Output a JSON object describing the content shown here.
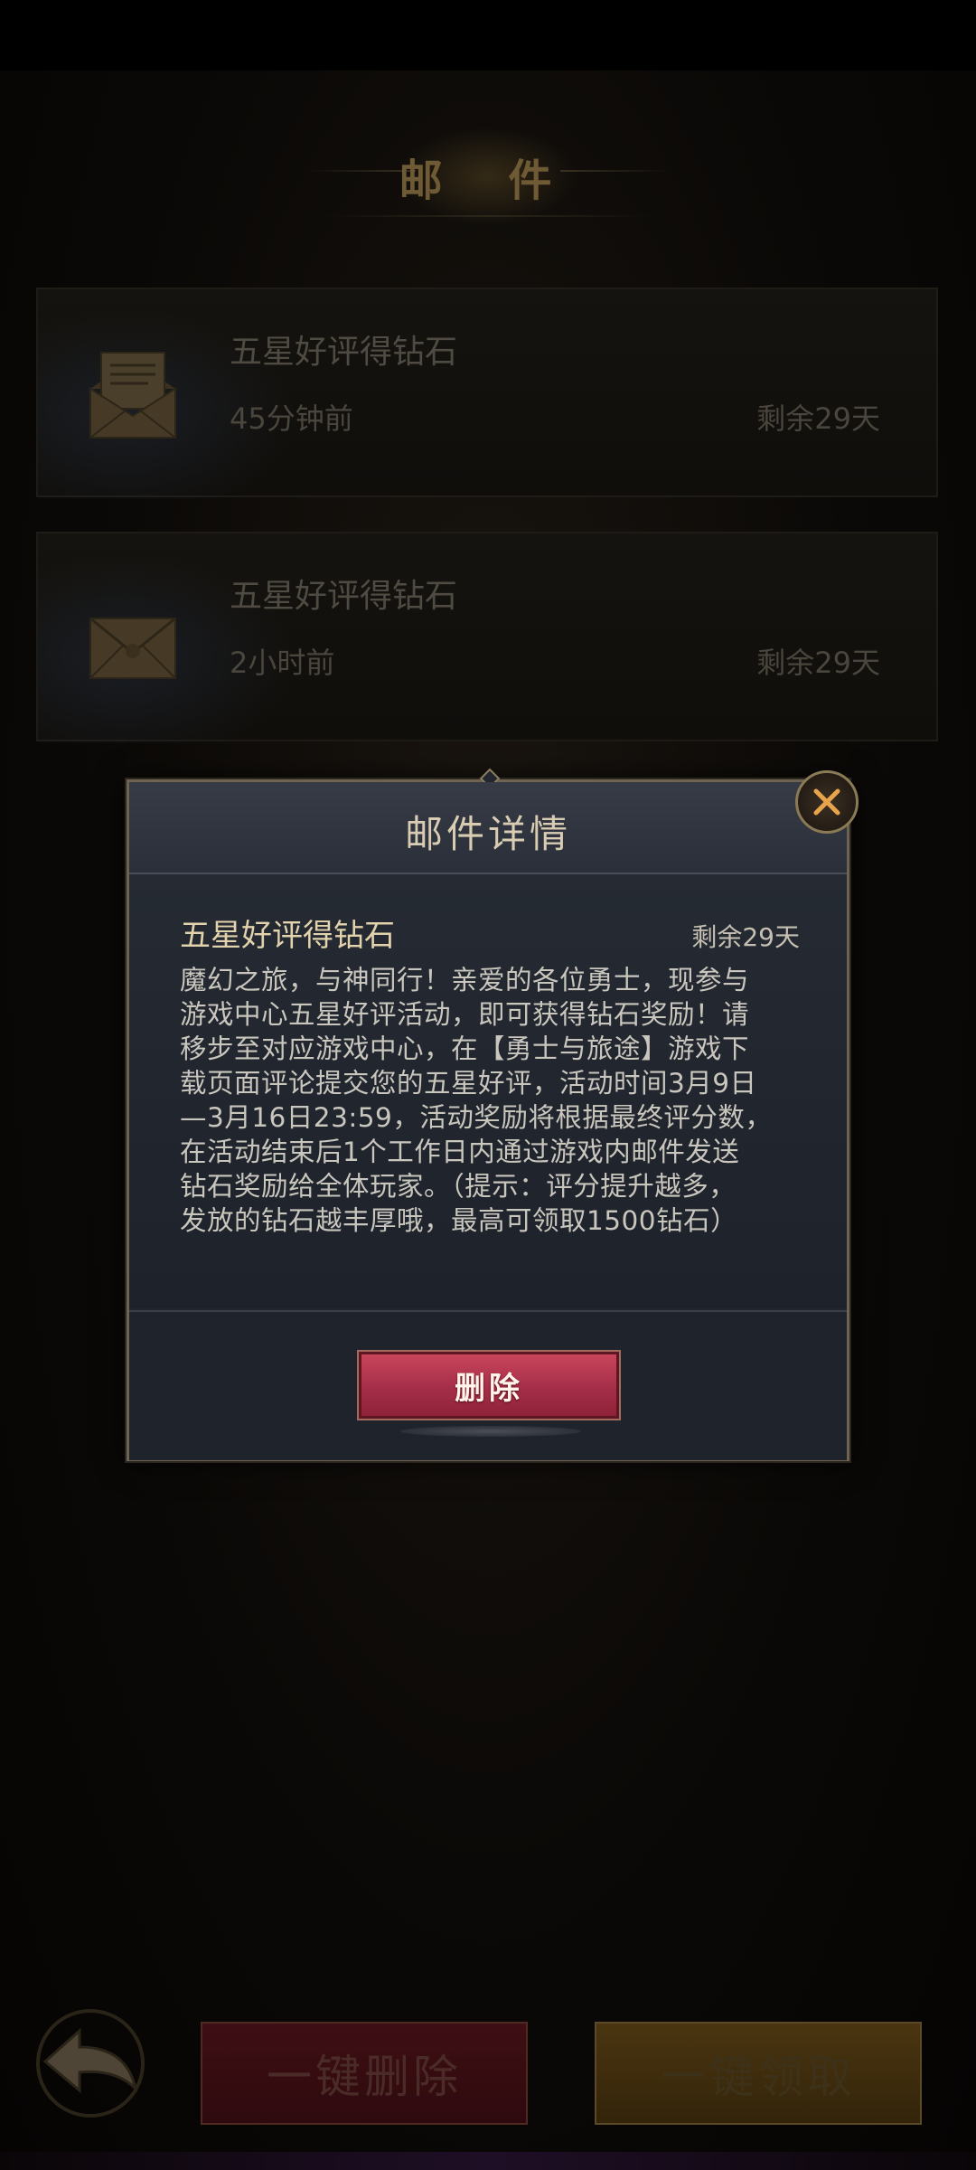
{
  "header": {
    "title": "邮 件"
  },
  "mail_list": [
    {
      "subject": "五星好评得钻石",
      "time": "45分钟前",
      "remaining": "剩余29天",
      "icon": "open-envelope-icon"
    },
    {
      "subject": "五星好评得钻石",
      "time": "2小时前",
      "remaining": "剩余29天",
      "icon": "closed-envelope-icon"
    }
  ],
  "detail_modal": {
    "title": "邮件详情",
    "subject": "五星好评得钻石",
    "remaining": "剩余29天",
    "body_lines": [
      "魔幻之旅，与神同行！亲爱的各位勇士，现参与",
      "游戏中心五星好评活动，即可获得钻石奖励！请",
      "移步至对应游戏中心，在【勇士与旅途】游戏下",
      "载页面评论提交您的五星好评，活动时间3月9日",
      "—3月16日23:59，活动奖励将根据最终评分数，",
      "在活动结束后1个工作日内通过游戏内邮件发送",
      "钻石奖励给全体玩家。（提示：评分提升越多，",
      "发放的钻石越丰厚哦，最高可领取1500钻石）"
    ],
    "delete_label": "删除",
    "close_icon": "close-icon"
  },
  "bottom_bar": {
    "back_icon": "back-arrow-icon",
    "delete_all_label": "一键删除",
    "claim_all_label": "一键领取"
  }
}
